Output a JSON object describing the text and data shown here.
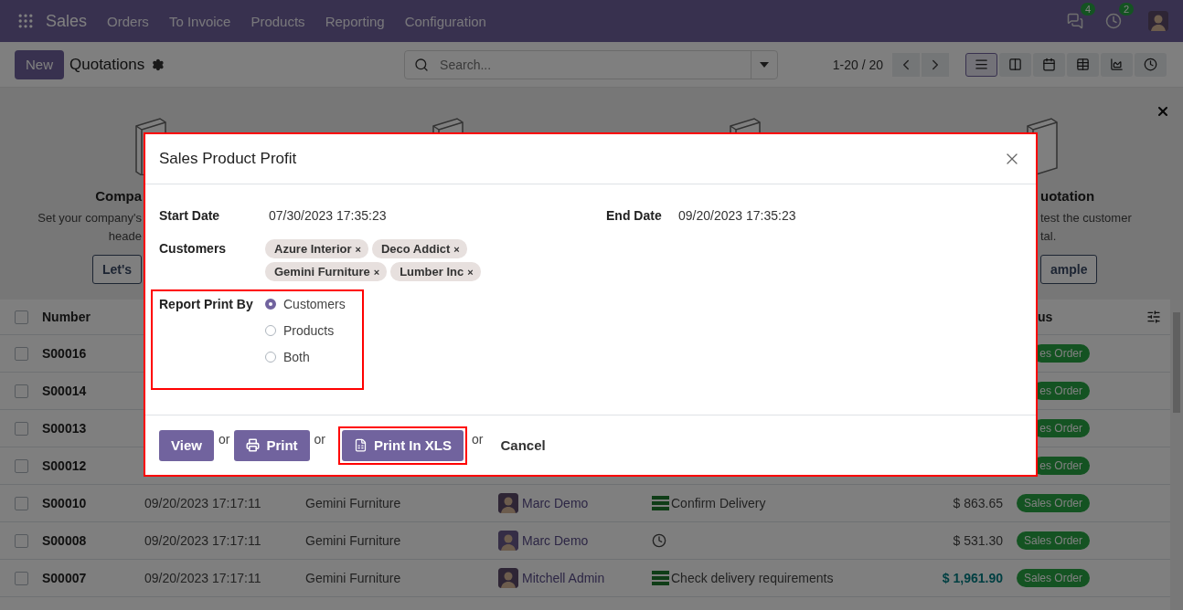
{
  "navbar": {
    "app": "Sales",
    "menus": [
      "Orders",
      "To Invoice",
      "Products",
      "Reporting",
      "Configuration"
    ],
    "notifications": [
      {
        "kind": "chat",
        "count": "4"
      },
      {
        "kind": "activity",
        "count": "2"
      }
    ]
  },
  "control_panel": {
    "new_button": "New",
    "title": "Quotations",
    "search": {
      "placeholder": "Search..."
    },
    "pager": "1-20 / 20",
    "views": [
      {
        "kind": "list",
        "selected": true
      },
      {
        "kind": "kanban",
        "selected": false
      },
      {
        "kind": "calendar",
        "selected": false
      },
      {
        "kind": "pivot",
        "selected": false
      },
      {
        "kind": "graph",
        "selected": false
      },
      {
        "kind": "activity",
        "selected": false
      }
    ]
  },
  "onboarding": {
    "steps": [
      {
        "kind": "left",
        "title": "Compa",
        "lines": [
          "Set your company's",
          "heade"
        ],
        "button": "Let's"
      },
      {
        "kind": "covered"
      },
      {
        "kind": "covered"
      },
      {
        "kind": "right",
        "title": "uotation",
        "lines": [
          "test the customer",
          "tal."
        ],
        "button": "ample"
      }
    ]
  },
  "table": {
    "header": {
      "checked": false,
      "columns": [
        "Number",
        "us"
      ]
    },
    "rows": [
      {
        "checked": false,
        "number": "S00016",
        "status": "es Order"
      },
      {
        "checked": false,
        "number": "S00014",
        "status": "es Order"
      },
      {
        "checked": false,
        "number": "S00013",
        "status": "es Order"
      },
      {
        "checked": false,
        "number": "S00012",
        "status": "es Order"
      },
      {
        "checked": false,
        "number": "S00010",
        "date": "09/20/2023 17:17:11",
        "customer": "Gemini Furniture",
        "salesperson": "Marc Demo",
        "activity": {
          "kind": "todo",
          "text": "Confirm Delivery"
        },
        "total": "$ 863.65",
        "emphasis": false,
        "status": "Sales Order"
      },
      {
        "checked": false,
        "number": "S00008",
        "date": "09/20/2023 17:17:11",
        "customer": "Gemini Furniture",
        "salesperson": "Marc Demo",
        "activity": {
          "kind": "clock"
        },
        "total": "$ 531.30",
        "emphasis": false,
        "status": "Sales Order"
      },
      {
        "checked": false,
        "number": "S00007",
        "date": "09/20/2023 17:17:11",
        "customer": "Gemini Furniture",
        "salesperson": "Mitchell Admin",
        "activity": {
          "kind": "todo",
          "text": "Check delivery requirements"
        },
        "total": "$ 1,961.90",
        "emphasis": true,
        "status": "Sales Order"
      }
    ]
  },
  "dialog": {
    "title": "Sales Product Profit",
    "start_date": {
      "label": "Start Date",
      "value": "07/30/2023 17:35:23"
    },
    "end_date": {
      "label": "End Date",
      "value": "09/20/2023 17:35:23"
    },
    "customers": {
      "label": "Customers",
      "tags": [
        {
          "label": "Azure Interior",
          "remove": "×"
        },
        {
          "label": "Deco Addict",
          "remove": "×"
        },
        {
          "label": "Gemini Furniture",
          "remove": "×"
        },
        {
          "label": "Lumber Inc",
          "remove": "×"
        }
      ]
    },
    "report_print_by": {
      "label": "Report Print By",
      "options": [
        {
          "label": "Customers",
          "selected": true
        },
        {
          "label": "Products",
          "selected": false
        },
        {
          "label": "Both",
          "selected": false
        }
      ]
    },
    "footer": [
      {
        "kind": "button",
        "label": "View"
      },
      {
        "kind": "or",
        "label": "or"
      },
      {
        "kind": "print",
        "label": "Print"
      },
      {
        "kind": "or",
        "label": "or"
      },
      {
        "kind": "xls",
        "label": "Print In XLS"
      },
      {
        "kind": "or",
        "label": "or"
      },
      {
        "kind": "link",
        "label": "Cancel"
      }
    ]
  }
}
